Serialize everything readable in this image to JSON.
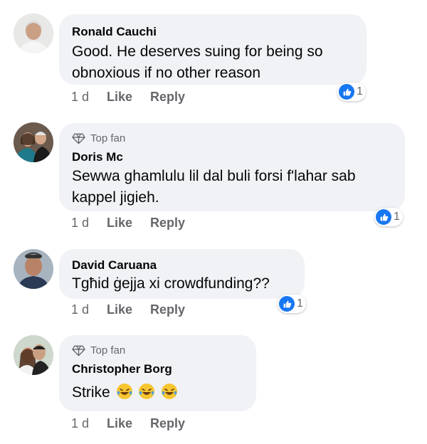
{
  "comments": [
    {
      "name": "Ronald Cauchi",
      "top_fan": false,
      "text_lines": [
        "Good. He deserves suing for being so",
        "obnoxious if no other reason"
      ],
      "time": "1 d",
      "like": "Like",
      "reply": "Reply",
      "reaction_count": "1",
      "reaction_icon": "like-icon"
    },
    {
      "name": "Doris Mc",
      "top_fan": true,
      "top_fan_label": "Top fan",
      "text_lines": [
        "Sewwa ghamlulu lil dal buli forsi f'lahar sab",
        "kappel jigieh."
      ],
      "time": "1 d",
      "like": "Like",
      "reply": "Reply",
      "reaction_count": "1",
      "reaction_icon": "like-icon"
    },
    {
      "name": "David Caruana",
      "top_fan": false,
      "text_lines": [
        "Tgħid ġejja xi crowdfunding??"
      ],
      "time": "1 d",
      "like": "Like",
      "reply": "Reply",
      "reaction_count": "1",
      "reaction_icon": "like-icon"
    },
    {
      "name": "Christopher Borg",
      "top_fan": true,
      "top_fan_label": "Top fan",
      "text": "Strike",
      "emoji": "laughing-tears-emoji",
      "time": "1 d",
      "like": "Like",
      "reply": "Reply"
    }
  ],
  "colors": {
    "bubble": "#f0f2f5",
    "meta_text": "#65676b",
    "like_blue": "#1877f2"
  }
}
